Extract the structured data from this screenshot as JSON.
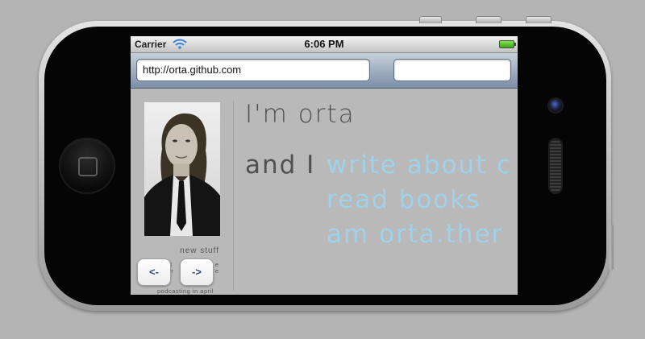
{
  "status_bar": {
    "carrier": "Carrier",
    "time": "6:06 PM"
  },
  "browser": {
    "url": "http://orta.github.com",
    "search_value": ""
  },
  "page": {
    "headline": "I'm orta",
    "and_i": "and I",
    "links": [
      "write about c",
      "read books",
      "am orta.ther"
    ],
    "new_stuff_label": "new stuff",
    "news_fragment_1": "d",
    "news_fragment_2": "e",
    "news_fragment_3": "ar",
    "news_fragment_4": "e",
    "podcast_note": "podcasting in april",
    "prev_button": "<-",
    "next_button": "->"
  },
  "colors": {
    "link": "#9fd2ea",
    "text": "#505050",
    "page_bg": "#b9b9b9"
  },
  "icons": [
    "wifi-icon",
    "battery-icon",
    "home-button-icon"
  ]
}
